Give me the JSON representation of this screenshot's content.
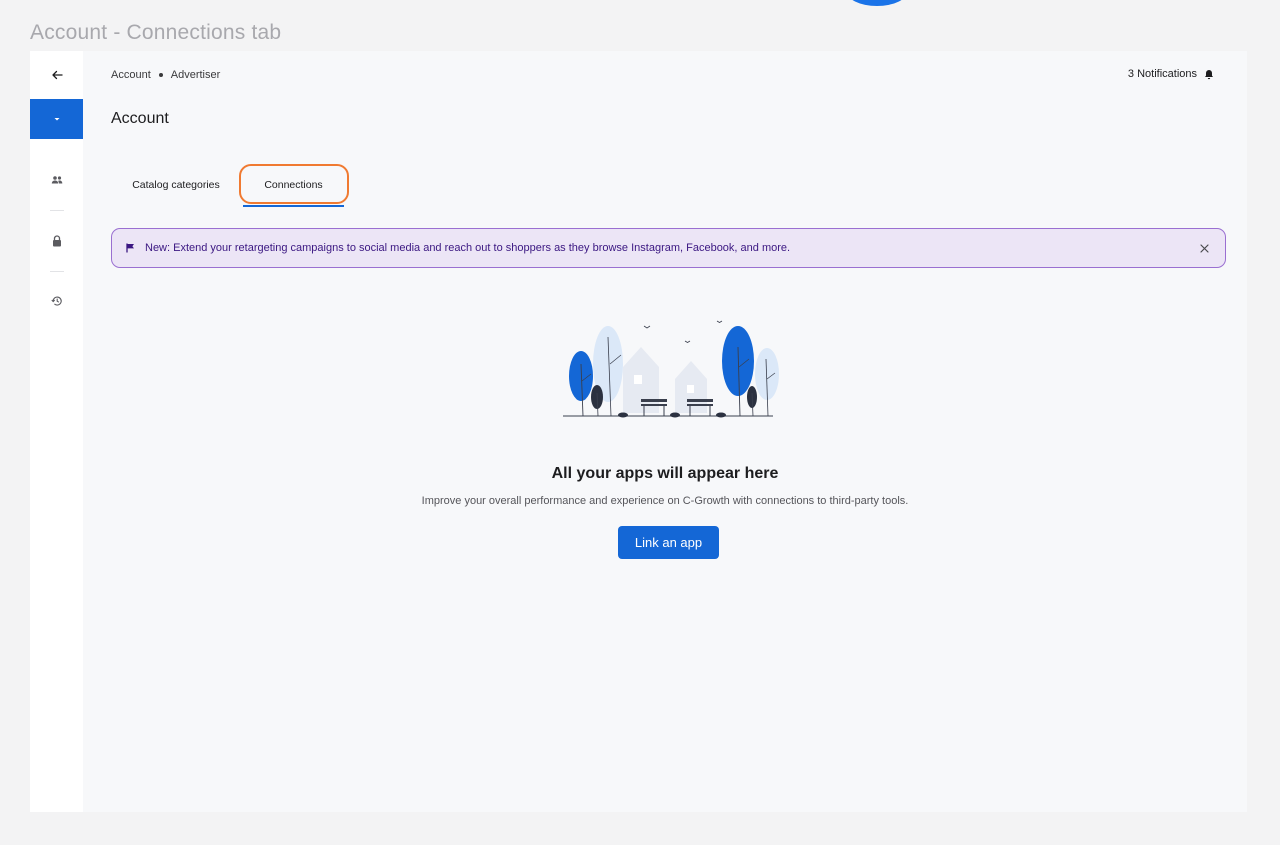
{
  "caption": "Account - Connections tab",
  "header": {
    "breadcrumb": [
      "Account",
      "Advertiser"
    ],
    "notifications": "3 Notifications",
    "title": "Account"
  },
  "tabs": [
    {
      "label": "Catalog categories",
      "active": false
    },
    {
      "label": "Connections",
      "active": true
    }
  ],
  "banner": {
    "text": "New: Extend your retargeting campaigns to social media and reach out to shoppers as they browse Instagram, Facebook, and more."
  },
  "empty_state": {
    "title": "All your apps will appear here",
    "subtitle": "Improve your overall performance and experience on C-Growth with connections to third-party tools.",
    "button": "Link an app"
  },
  "sidebar": {
    "icons": [
      "back-arrow-icon",
      "chevron-down-icon",
      "users-icon",
      "lock-icon",
      "history-icon"
    ]
  },
  "colors": {
    "accent": "#1467d6",
    "highlight": "#f07a31",
    "banner_bg": "#ece5f6",
    "banner_border": "#9a6fd1"
  }
}
